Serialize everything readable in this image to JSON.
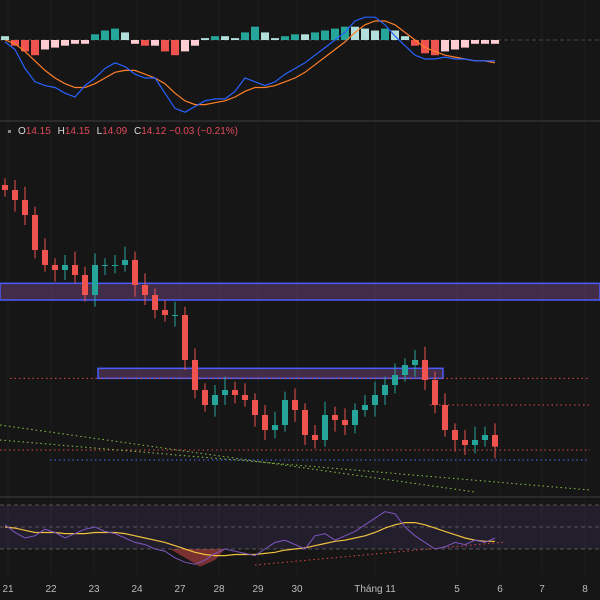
{
  "legend": {
    "o_label": "O",
    "o": "14.15",
    "h_label": "H",
    "h": "14.15",
    "l_label": "L",
    "l": "14.09",
    "c_label": "C",
    "c": "14.12",
    "change": "−0.03 (−0.21%)"
  },
  "x_axis": [
    "21",
    "22",
    "23",
    "24",
    "27",
    "28",
    "29",
    "30",
    "Tháng 11",
    "5",
    "6",
    "7",
    "8"
  ],
  "colors": {
    "up": "#26a69a",
    "down": "#ef5350",
    "bg": "#161616",
    "zone": "#4a5cff",
    "macd": "#2962ff",
    "signal": "#ff7f27",
    "rsi": "#7e57c2",
    "rsi_ma": "#f0c040"
  },
  "chart_data": {
    "type": "candlestick",
    "ylim": [
      13.83,
      15.9
    ],
    "closes": [
      15.66,
      15.6,
      15.51,
      15.3,
      15.21,
      15.18,
      15.21,
      15.15,
      15.03,
      15.21,
      15.21,
      15.21,
      15.24,
      15.09,
      15.03,
      14.94,
      14.91,
      14.91,
      14.64,
      14.46,
      14.37,
      14.43,
      14.46,
      14.43,
      14.4,
      14.31,
      14.22,
      14.25,
      14.4,
      14.34,
      14.19,
      14.16,
      14.31,
      14.28,
      14.25,
      14.34,
      14.37,
      14.43,
      14.49,
      14.55,
      14.61,
      14.64,
      14.52,
      14.37,
      14.22,
      14.16,
      14.13,
      14.16,
      14.19,
      14.12
    ],
    "zones": [
      {
        "top": 15.1,
        "bottom": 15.0
      },
      {
        "top": 14.59,
        "bottom": 14.53
      }
    ],
    "levels_red": [
      14.53,
      14.37,
      14.1
    ],
    "level_blue": 14.04,
    "macd": {
      "hist": [
        0.02,
        -0.03,
        -0.06,
        -0.08,
        -0.05,
        -0.04,
        -0.03,
        -0.02,
        -0.02,
        0.03,
        0.05,
        0.06,
        0.04,
        -0.02,
        -0.03,
        -0.03,
        -0.06,
        -0.08,
        -0.06,
        -0.03,
        0.01,
        0.02,
        0.02,
        0.01,
        0.04,
        0.07,
        0.04,
        0.01,
        0.02,
        0.03,
        0.03,
        0.04,
        0.05,
        0.06,
        0.07,
        0.07,
        0.06,
        0.05,
        0.06,
        0.05,
        0.02,
        -0.03,
        -0.07,
        -0.08,
        -0.06,
        -0.05,
        -0.04,
        -0.02,
        -0.02,
        -0.02
      ],
      "line": [
        -0.01,
        -0.05,
        -0.15,
        -0.22,
        -0.24,
        -0.25,
        -0.28,
        -0.3,
        -0.24,
        -0.2,
        -0.15,
        -0.12,
        -0.14,
        -0.18,
        -0.2,
        -0.2,
        -0.28,
        -0.36,
        -0.38,
        -0.35,
        -0.32,
        -0.31,
        -0.31,
        -0.27,
        -0.2,
        -0.22,
        -0.24,
        -0.22,
        -0.18,
        -0.15,
        -0.12,
        -0.08,
        -0.04,
        0,
        0.04,
        0.1,
        0.12,
        0.12,
        0.08,
        0.02,
        -0.03,
        -0.08,
        -0.1,
        -0.1,
        -0.09,
        -0.1,
        -0.1,
        -0.11,
        -0.11,
        -0.11
      ],
      "signal": [
        0,
        -0.02,
        -0.06,
        -0.11,
        -0.16,
        -0.2,
        -0.23,
        -0.25,
        -0.25,
        -0.23,
        -0.2,
        -0.17,
        -0.16,
        -0.16,
        -0.18,
        -0.2,
        -0.23,
        -0.28,
        -0.32,
        -0.34,
        -0.34,
        -0.33,
        -0.32,
        -0.3,
        -0.27,
        -0.25,
        -0.25,
        -0.24,
        -0.22,
        -0.2,
        -0.17,
        -0.13,
        -0.09,
        -0.05,
        -0.01,
        0.04,
        0.08,
        0.1,
        0.1,
        0.08,
        0.04,
        0,
        -0.04,
        -0.06,
        -0.08,
        -0.09,
        -0.1,
        -0.11,
        -0.11,
        -0.12
      ]
    },
    "rsi": {
      "levels": [
        70,
        50,
        30
      ],
      "values": [
        52,
        45,
        40,
        42,
        48,
        45,
        40,
        44,
        48,
        50,
        46,
        44,
        40,
        36,
        34,
        30,
        28,
        22,
        18,
        16,
        20,
        26,
        30,
        28,
        26,
        24,
        30,
        36,
        38,
        34,
        30,
        42,
        44,
        38,
        42,
        46,
        52,
        58,
        64,
        62,
        50,
        42,
        36,
        30,
        32,
        36,
        34,
        38,
        36,
        40
      ],
      "ma": [
        50,
        49,
        47,
        45,
        45,
        45,
        44,
        44,
        44,
        45,
        45,
        45,
        44,
        42,
        40,
        38,
        36,
        33,
        30,
        27,
        25,
        24,
        24,
        25,
        25,
        25,
        26,
        27,
        29,
        30,
        31,
        33,
        35,
        37,
        38,
        40,
        42,
        45,
        49,
        52,
        54,
        54,
        52,
        49,
        46,
        43,
        40,
        38,
        37,
        37
      ]
    }
  }
}
